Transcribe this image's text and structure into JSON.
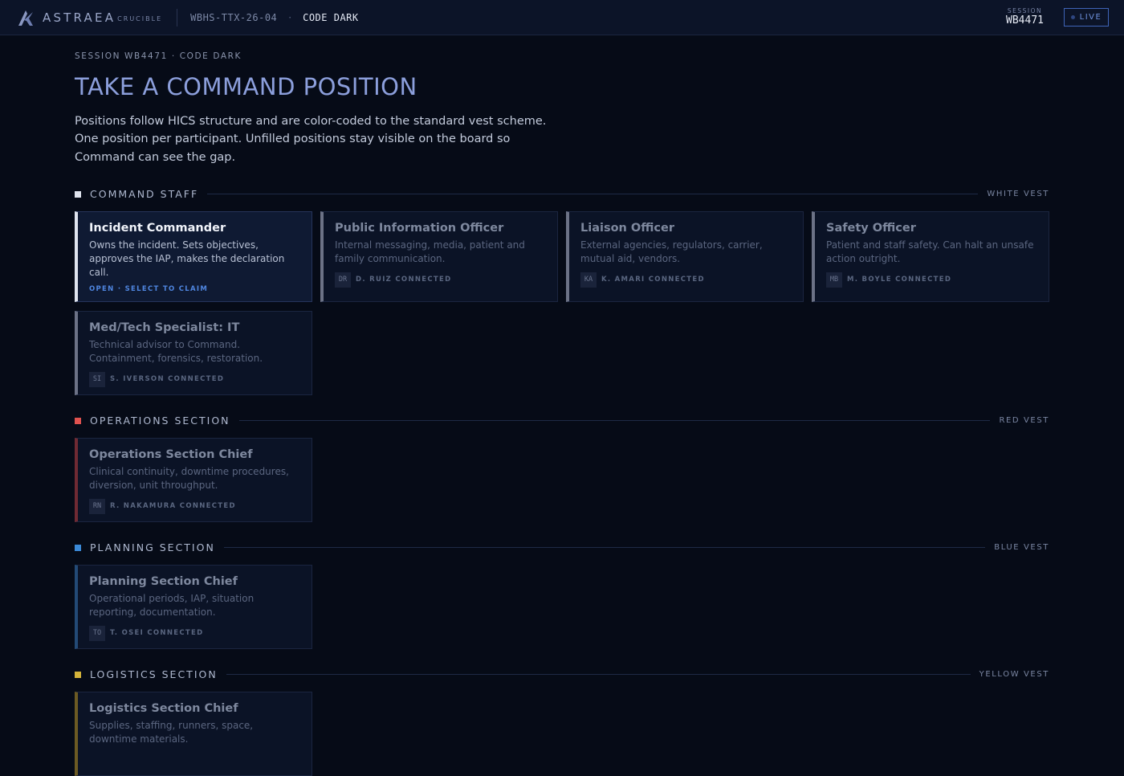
{
  "topbar": {
    "brand_name": "ASTRAEA",
    "brand_sub": "CRUCIBLE",
    "exercise_id": "WBHS-TTX-26-04",
    "separator": "·",
    "scenario": "CODE DARK",
    "session_label": "SESSION",
    "session_value": "WB4471",
    "live_label": "LIVE"
  },
  "main": {
    "eyebrow": "SESSION WB4471 · CODE DARK",
    "title": "TAKE A COMMAND POSITION",
    "intro": "Positions follow HICS structure and are color-coded to the standard vest scheme. One position per participant. Unfilled positions stay visible on the board so Command can see the gap."
  },
  "colors": {
    "command": "#dfe4ee",
    "operations": "#e0524f",
    "planning": "#3b8ad8",
    "logistics": "#d4b33a",
    "command_border": "#6c7286",
    "operations_border": "#6f2a33",
    "planning_border": "#234a76",
    "logistics_border": "#6c5a23",
    "open_accent": "#4f86e0"
  },
  "sections": {
    "command": {
      "title": "COMMAND STAFF",
      "vest": "WHITE VEST",
      "cards": [
        {
          "title": "Incident Commander",
          "desc": "Owns the incident. Sets objectives, approves the IAP, makes the declaration call.",
          "status": "OPEN · SELECT TO CLAIM"
        },
        {
          "title": "Public Information Officer",
          "desc": "Internal messaging, media, patient and family communication.",
          "initials": "DR",
          "status": "D. RUIZ CONNECTED"
        },
        {
          "title": "Liaison Officer",
          "desc": "External agencies, regulators, carrier, mutual aid, vendors.",
          "initials": "KA",
          "status": "K. AMARI CONNECTED"
        },
        {
          "title": "Safety Officer",
          "desc": "Patient and staff safety. Can halt an unsafe action outright.",
          "initials": "MB",
          "status": "M. BOYLE CONNECTED"
        },
        {
          "title": "Med/Tech Specialist: IT",
          "desc": "Technical advisor to Command. Containment, forensics, restoration.",
          "initials": "SI",
          "status": "S. IVERSON CONNECTED"
        }
      ]
    },
    "operations": {
      "title": "OPERATIONS SECTION",
      "vest": "RED VEST",
      "cards": [
        {
          "title": "Operations Section Chief",
          "desc": "Clinical continuity, downtime procedures, diversion, unit throughput.",
          "initials": "RN",
          "status": "R. NAKAMURA CONNECTED"
        }
      ]
    },
    "planning": {
      "title": "PLANNING SECTION",
      "vest": "BLUE VEST",
      "cards": [
        {
          "title": "Planning Section Chief",
          "desc": "Operational periods, IAP, situation reporting, documentation.",
          "initials": "TO",
          "status": "T. OSEI CONNECTED"
        }
      ]
    },
    "logistics": {
      "title": "LOGISTICS SECTION",
      "vest": "YELLOW VEST",
      "cards": [
        {
          "title": "Logistics Section Chief",
          "desc": "Supplies, staffing, runners, space, downtime materials."
        }
      ]
    }
  }
}
